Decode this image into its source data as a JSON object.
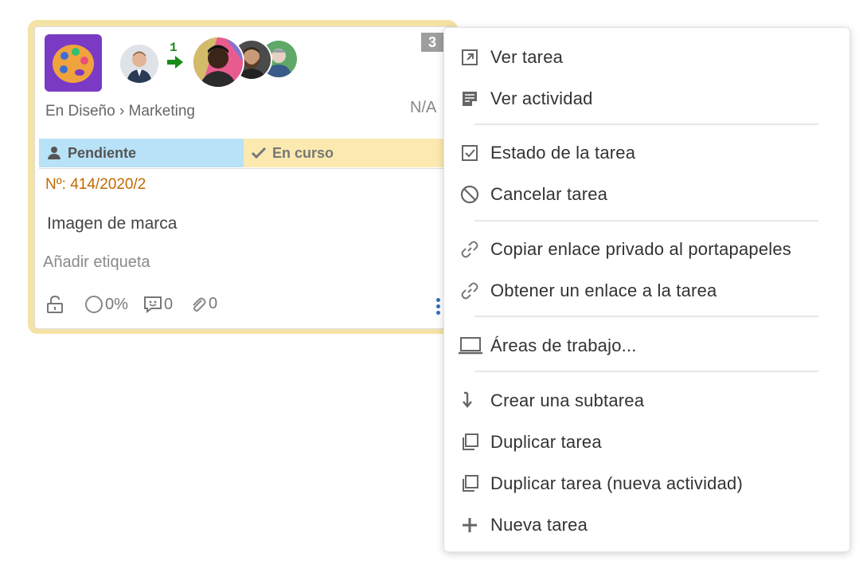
{
  "card": {
    "status_count": "3",
    "order_number": "1",
    "breadcrumb": "En Diseño › Marketing",
    "due": "N/A",
    "status_pending": "Pendiente",
    "status_in_progress": "En curso",
    "task_number": "Nº: 414/2020/2",
    "task_title": "Imagen de marca",
    "add_tag": "Añadir etiqueta",
    "progress": "0%",
    "comments": "0",
    "attachments": "0",
    "colors": {
      "outline": "#f5e3a6",
      "pending": "#b8e2f7",
      "in_progress": "#fbe9b0",
      "task_number": "#c06a00",
      "badge": "#9e9e9e",
      "app_icon": "#7b3ac4"
    }
  },
  "menu": {
    "items": [
      {
        "label": "Ver tarea",
        "icon": "external-link-icon"
      },
      {
        "label": "Ver actividad",
        "icon": "activity-note-icon"
      },
      {
        "label": "Estado de la tarea",
        "icon": "checkbox-icon"
      },
      {
        "label": "Cancelar tarea",
        "icon": "cancel-icon"
      },
      {
        "label": "Copiar enlace privado al portapapeles",
        "icon": "link-icon"
      },
      {
        "label": "Obtener un enlace a la tarea",
        "icon": "link-icon"
      },
      {
        "label": "Áreas de trabajo...",
        "icon": "laptop-icon"
      },
      {
        "label": "Crear una subtarea",
        "icon": "subtask-arrow-icon"
      },
      {
        "label": "Duplicar tarea",
        "icon": "duplicate-icon"
      },
      {
        "label": "Duplicar tarea (nueva actividad)",
        "icon": "duplicate-icon"
      },
      {
        "label": "Nueva tarea",
        "icon": "plus-icon"
      }
    ]
  }
}
